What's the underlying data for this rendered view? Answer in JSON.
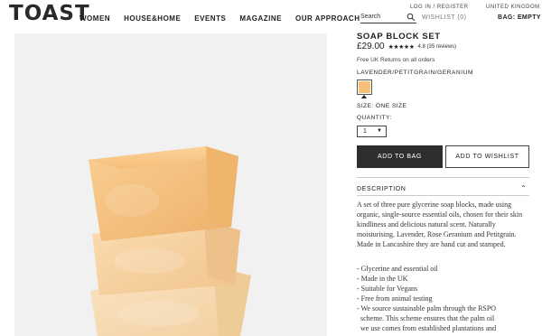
{
  "header": {
    "logo": "TOAST",
    "nav": [
      "WOMEN",
      "HOUSE&HOME",
      "EVENTS",
      "MAGAZINE",
      "OUR APPROACH"
    ],
    "login": "LOG IN / REGISTER",
    "country": "UNITED KINGDOM",
    "search_placeholder": "Search",
    "wishlist": "WISHLIST (0)",
    "bag": "BAG: EMPTY"
  },
  "product": {
    "title": "SOAP BLOCK SET",
    "price": "£29.00",
    "stars": "★★★★★",
    "rating": "4.8 (35 reviews)",
    "returns": "Free UK Returns on all orders",
    "fragrance": "LAVENDER/PETITGRAIN/GERANIUM",
    "swatch_color": "#f6c078",
    "size": "SIZE: ONE SIZE",
    "quantity_label": "QUANTITY:",
    "quantity_value": "1",
    "add_to_bag": "ADD TO BAG",
    "add_to_wishlist": "ADD TO WISHLIST"
  },
  "description": {
    "heading": "DESCRIPTION",
    "text": "A set of three pure glycerine soap blocks, made using organic, single-source essential oils, chosen for their skin kindliness and delicious natural scent. Naturally moisturising. Lavender, Rose Geranium and Petitgrain. Made in Lancashire they are hand cut and stamped.",
    "bullets": [
      "- Glycerine and essential oil",
      "- Made in the UK",
      "- Suitable for Vegans",
      "- Free from animal testing",
      "- We source sustainable palm through the RSPO\n  scheme. This scheme ensures that the palm oil\n  we use comes from established plantations and"
    ]
  }
}
